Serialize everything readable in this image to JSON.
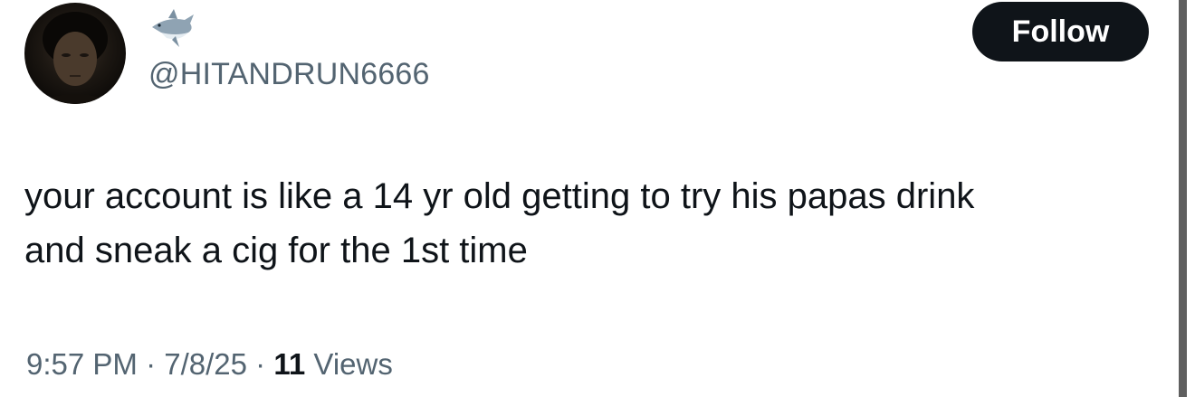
{
  "tweet": {
    "author": {
      "name_emoji": "shark-icon",
      "handle": "@HITANDRUN6666",
      "avatar": "avatar-photo"
    },
    "follow_label": "Follow",
    "text_lines": [
      "your account is like a 14 yr old getting to try his papas drink",
      "and sneak a cig for the 1st time"
    ],
    "time": "9:57 PM",
    "separator": "·",
    "date": "7/8/25",
    "views_count": "11",
    "views_label": "Views"
  },
  "colors": {
    "text": "#0f1419",
    "secondary": "#536471",
    "button_bg": "#0f1419",
    "button_text": "#ffffff"
  }
}
